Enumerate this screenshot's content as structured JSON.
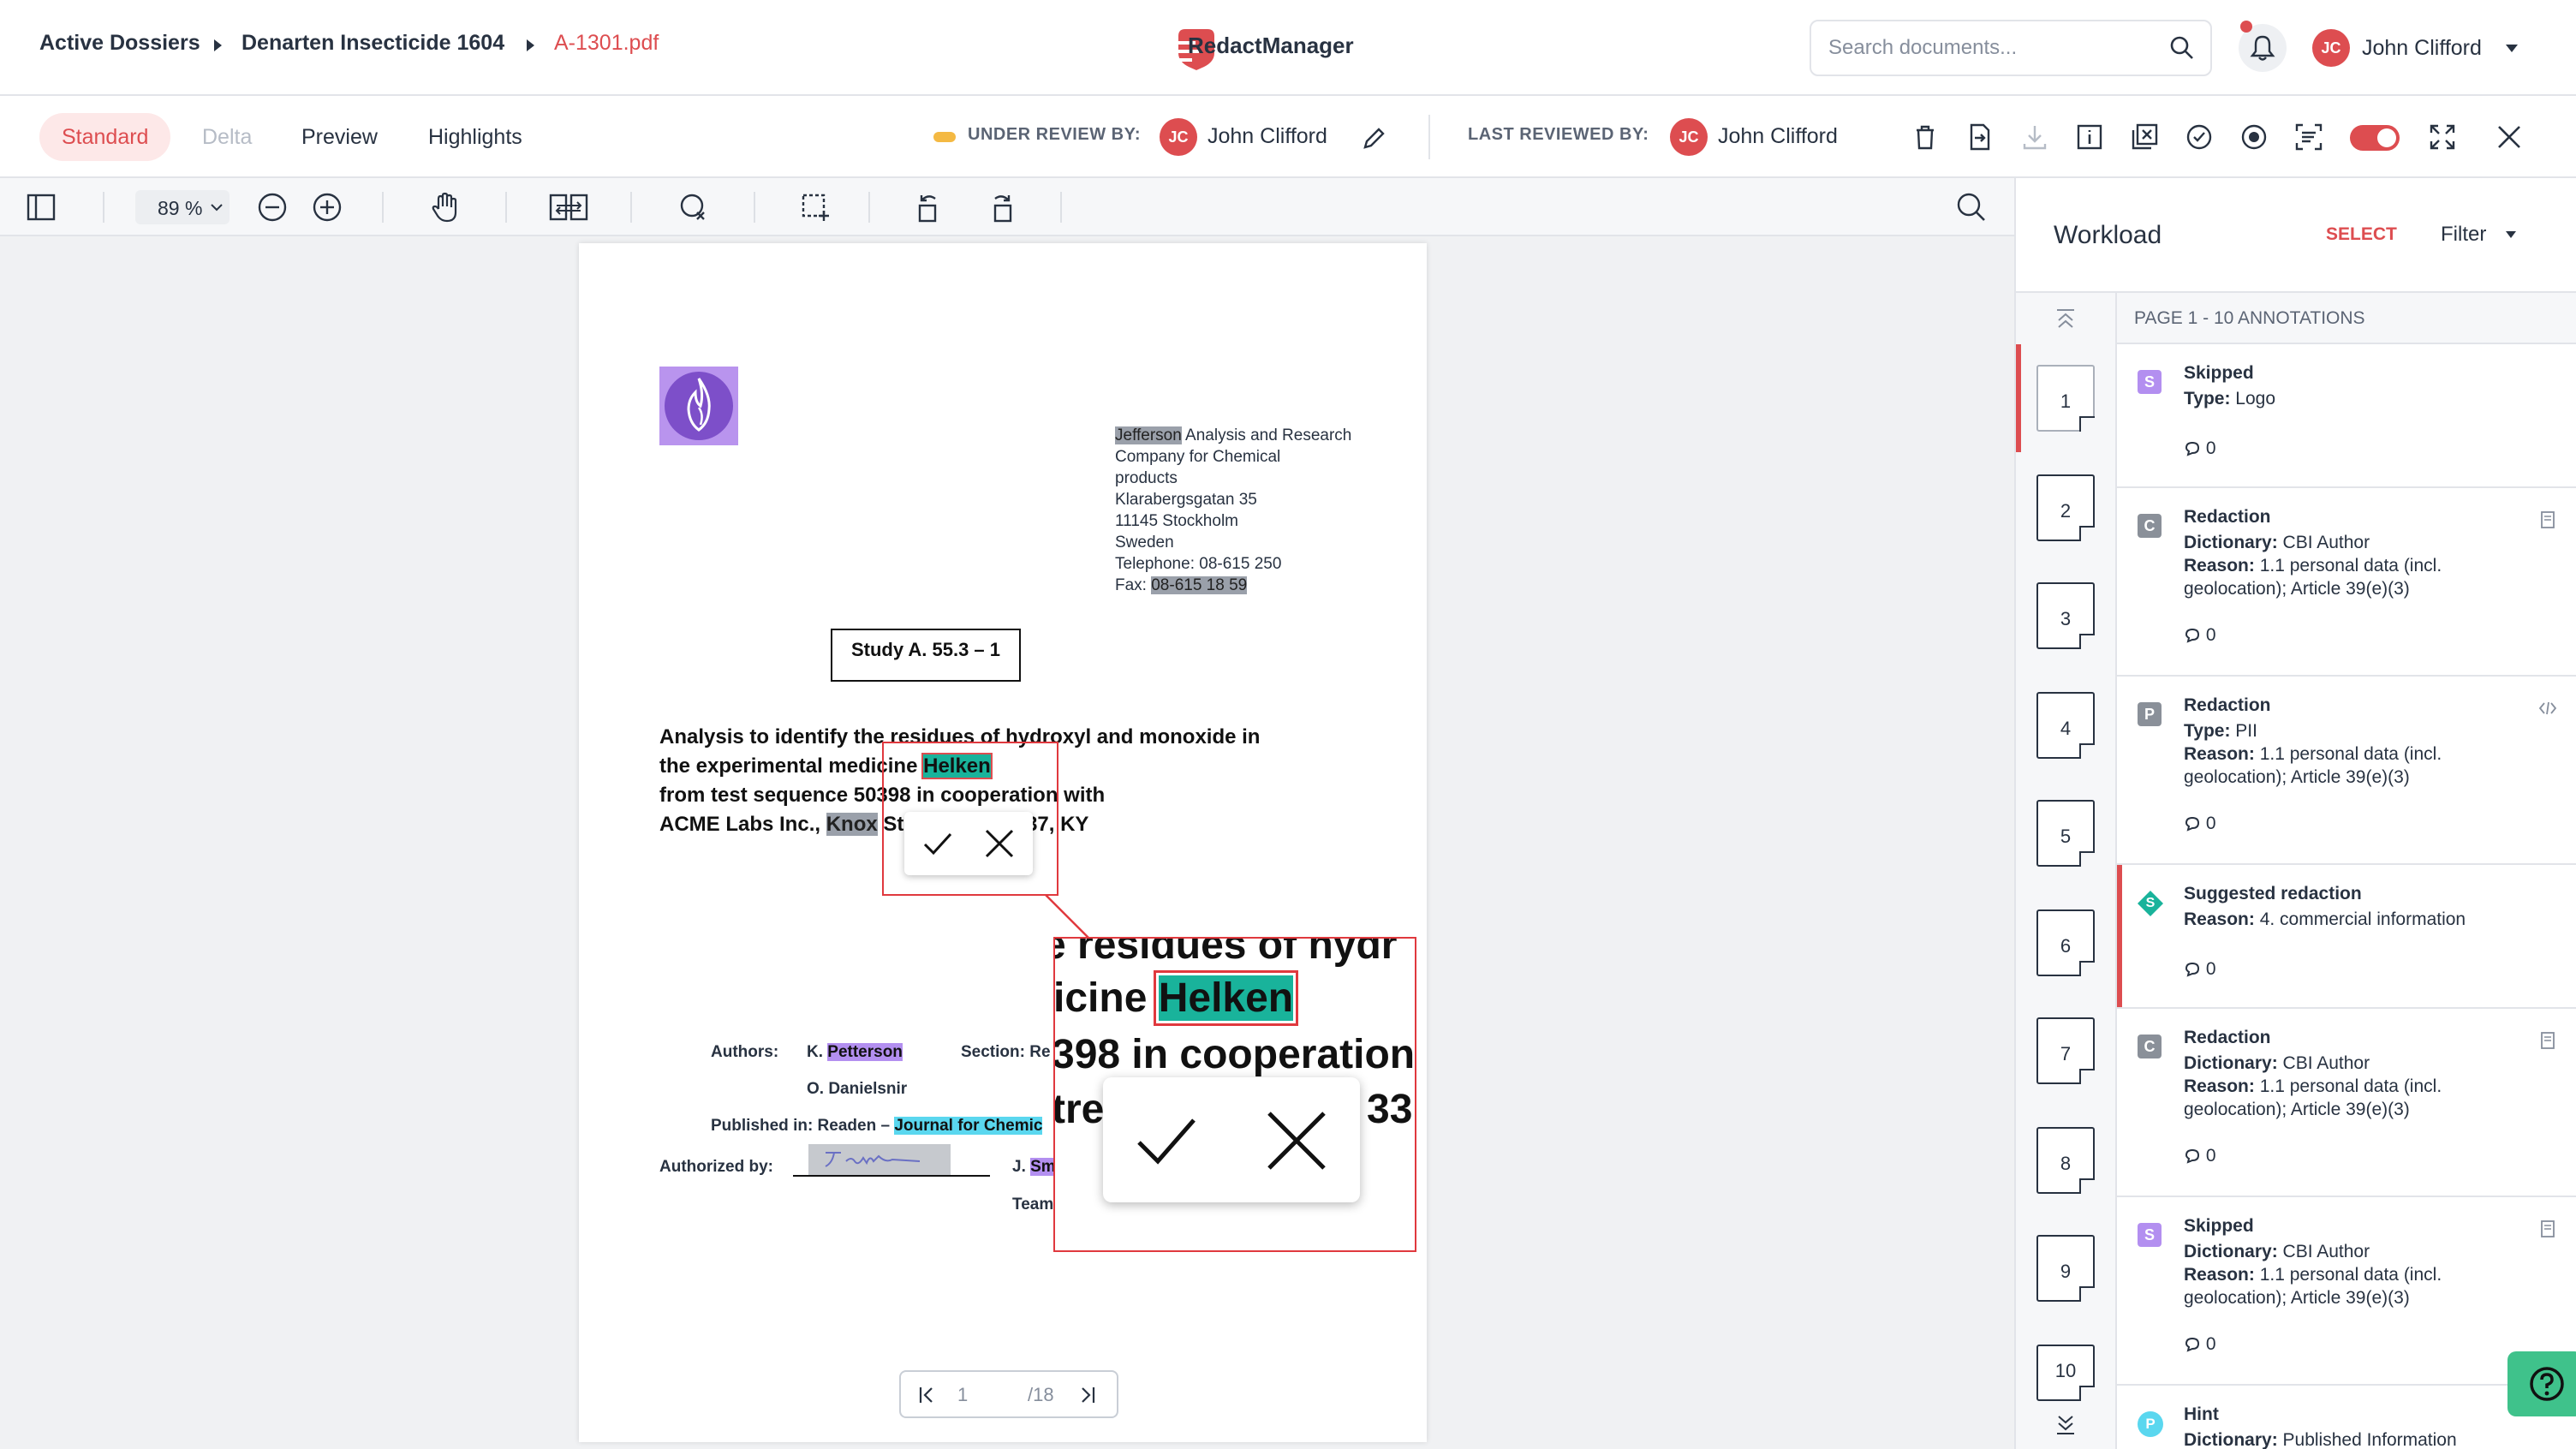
{
  "breadcrumb": {
    "items": [
      "Active Dossiers",
      "Denarten Insecticide 1604",
      "A-1301.pdf"
    ]
  },
  "app": {
    "name": "RedactManager"
  },
  "search": {
    "placeholder": "Search documents..."
  },
  "user": {
    "initials": "JC",
    "name": "John Clifford"
  },
  "view_tabs": [
    "Standard",
    "Delta",
    "Preview",
    "Highlights"
  ],
  "review": {
    "under_label": "UNDER REVIEW BY:",
    "under_initials": "JC",
    "under_name": "John Clifford",
    "last_label": "LAST REVIEWED BY:",
    "last_initials": "JC",
    "last_name": "John Clifford"
  },
  "viewer": {
    "zoom": "89 %",
    "page_current": "1",
    "page_total": "/18"
  },
  "document": {
    "company": {
      "highlight": "Jefferson",
      "line1_rest": " Analysis and Research",
      "lines": [
        "Company for Chemical",
        "products",
        "Klarabergsgatan 35",
        "11145 Stockholm",
        "Sweden",
        "Telephone: 08-615 250"
      ],
      "fax_label": "Fax: ",
      "fax_value": "08-615 18 59"
    },
    "study": "Study A. 55.3 – 1",
    "title": {
      "l1": "Analysis to identify the residues of hydroxyl and monoxide in",
      "l2_pre": "the experimental medicine ",
      "l2_hl": "Helken",
      "l3": "from test sequence 50398 in cooperation with",
      "l4_pre": "ACME Labs Inc., ",
      "l4_hl": "Knox",
      "l4_a": " Str",
      "l4_b": "337, KY"
    },
    "authors_label": "Authors:",
    "author1_pre": "K. ",
    "author1_hl": "Petterson",
    "author2": "O. Danielsnir",
    "section_label": "Section: Re",
    "published_label": "Published in: Readen – ",
    "published_hl": "Journal for Chemic",
    "authorized_label": "Authorized by:",
    "signature": "J. Smile",
    "signer_pre": "J. ",
    "signer_hl": "Smi",
    "team": "Team",
    "zoom": {
      "line1": "e residues of hydr",
      "line2_pre": "icine ",
      "line2_hl": "Helken",
      "line3": "398 in cooperation",
      "line4": "tre",
      "line4b": "33"
    }
  },
  "workload": {
    "title": "Workload",
    "select": "SELECT",
    "filter": "Filter",
    "page_header": "PAGE 1 - 10 ANNOTATIONS",
    "pages": [
      "1",
      "2",
      "3",
      "4",
      "5",
      "6",
      "7",
      "8",
      "9",
      "10"
    ],
    "annotations": [
      {
        "badge": "S",
        "title": "Skipped",
        "l1k": "Type:",
        "l1v": " Logo",
        "l2k": "",
        "l2v": "",
        "l3": "",
        "comments": "0"
      },
      {
        "badge": "C",
        "title": "Redaction",
        "l1k": "Dictionary:",
        "l1v": " CBI Author",
        "l2k": "Reason:",
        "l2v": " 1.1 personal data (incl.",
        "l3": "geolocation); Article 39(e)(3)",
        "comments": "0"
      },
      {
        "badge": "P",
        "title": "Redaction",
        "l1k": "Type:",
        "l1v": " PII",
        "l2k": "Reason:",
        "l2v": " 1.1 personal data (incl.",
        "l3": "geolocation); Article 39(e)(3)",
        "comments": "0"
      },
      {
        "badge": "S",
        "title": "Suggested redaction",
        "l1k": "Reason:",
        "l1v": " 4. commercial information",
        "l2k": "",
        "l2v": "",
        "l3": "",
        "comments": "0"
      },
      {
        "badge": "C",
        "title": "Redaction",
        "l1k": "Dictionary:",
        "l1v": " CBI Author",
        "l2k": "Reason:",
        "l2v": " 1.1 personal data (incl.",
        "l3": "geolocation); Article 39(e)(3)",
        "comments": "0"
      },
      {
        "badge": "S",
        "title": "Skipped",
        "l1k": "Dictionary:",
        "l1v": " CBI Author",
        "l2k": "Reason:",
        "l2v": " 1.1 personal data (incl.",
        "l3": "geolocation); Article 39(e)(3)",
        "comments": "0"
      },
      {
        "badge": "P",
        "title": "Hint",
        "l1k": "Dictionary:",
        "l1v": " Published Information",
        "l2k": "",
        "l2v": "",
        "l3": "",
        "comments": ""
      }
    ]
  },
  "colors": {
    "accent": "#dd4d50",
    "teal": "#19b39b",
    "purple": "#b38ff0",
    "gray_badge": "#8a9099",
    "help": "#3fc28b"
  }
}
